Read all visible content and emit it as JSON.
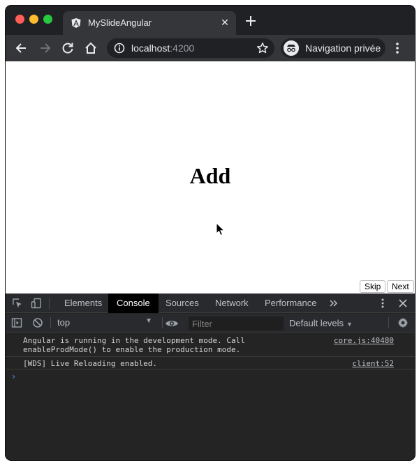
{
  "browser": {
    "tab": {
      "title": "MySlideAngular",
      "favicon": "angular-logo-icon"
    },
    "address": {
      "host": "localhost",
      "port": ":4200"
    },
    "profile_label": "Navigation privée"
  },
  "page": {
    "heading": "Add",
    "buttons": {
      "skip": "Skip",
      "next": "Next"
    }
  },
  "devtools": {
    "tabs": [
      "Elements",
      "Console",
      "Sources",
      "Network",
      "Performance"
    ],
    "active_tab": "Console",
    "context": "top",
    "filter_placeholder": "Filter",
    "levels_label": "Default levels",
    "messages": [
      {
        "text": "Angular is running in the development mode. Call\nenableProdMode() to enable the production mode.",
        "source": "core.js:40480"
      },
      {
        "text": "[WDS] Live Reloading enabled.",
        "source": "client:52"
      }
    ],
    "prompt_symbol": "›"
  },
  "colors": {
    "window_bg": "#202124",
    "toolbar_bg": "#35363a",
    "devtools_bg": "#242424",
    "accent_blue": "#4f8df7"
  }
}
